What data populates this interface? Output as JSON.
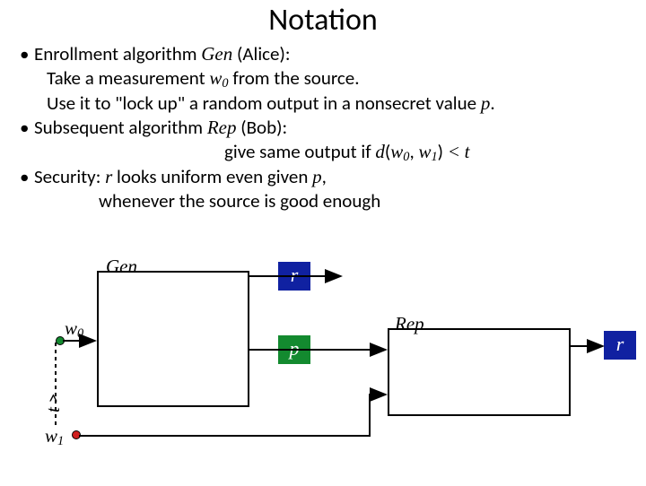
{
  "title": "Notation",
  "bullets": {
    "l1a": "Enrollment algorithm",
    "gen": "Gen",
    "l1b": "(Alice):",
    "l2a": "Take a measurement",
    "w0": "w",
    "w0sub": "0",
    "l2b": "from the source.",
    "l3a": "Use it to \"lock up\" a random output in a nonsecret value",
    "p": "p",
    "dot": ".",
    "l4a": "Subsequent algorithm",
    "rep": "Rep",
    "l4b": "(Bob):",
    "l5a": "give same output if",
    "d": "d",
    "lp": "(",
    "comma": ",",
    "w1": "w",
    "w1sub": "1",
    "rp": ")",
    "lt": "<",
    "tvar": "t",
    "l6a": "Security:",
    "rvar": "r",
    "l6b": "looks uniform even given",
    "l7": "whenever the source is good enough"
  },
  "diagram": {
    "gen": "Gen",
    "rep": "Rep",
    "r1": "r",
    "r2": "r",
    "p": "p",
    "w0": "w",
    "w0sub": "0",
    "w1": "w",
    "w1sub": "1",
    "tlabel": "t"
  }
}
